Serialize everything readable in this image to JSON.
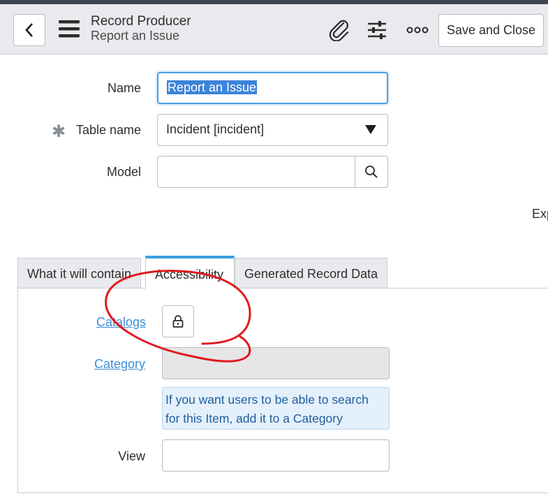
{
  "header": {
    "title": "Record Producer",
    "subtitle": "Report an Issue",
    "save_label": "Save and Close"
  },
  "form": {
    "name_label": "Name",
    "name_value": "Report an Issue",
    "table_label": "Table name",
    "table_value": "Incident [incident]",
    "model_label": "Model",
    "model_value": "",
    "partial_text": "Exp"
  },
  "tabs": [
    {
      "label": "What it will contain",
      "active": false
    },
    {
      "label": "Accessibility",
      "active": true
    },
    {
      "label": "Generated Record Data",
      "active": false
    }
  ],
  "accessibility": {
    "catalogs_label": "Catalogs",
    "category_label": "Category",
    "category_value": "",
    "info_text": "If you want users to be able to search for this Item, add it to a Category",
    "view_label": "View",
    "view_value": ""
  },
  "colors": {
    "accent": "#3d9ee0",
    "link": "#3c8ed6",
    "annotation": "#e0191f"
  },
  "icons": [
    "back-icon",
    "menu-icon",
    "paperclip-icon",
    "settings-sliders-icon",
    "more-icon",
    "search-icon",
    "lock-icon",
    "required-star-icon",
    "dropdown-caret-icon"
  ]
}
